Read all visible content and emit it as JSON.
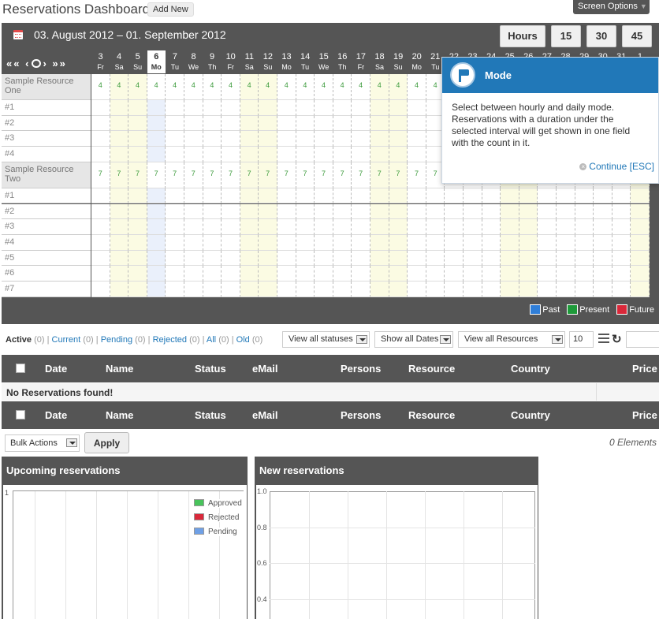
{
  "header": {
    "title": "Reservations Dashboard",
    "add_new": "Add New",
    "screen_options": "Screen Options",
    "screen_options_icon": "chevron-down-icon"
  },
  "calendar": {
    "range": "03. August 2012 – 01. September 2012",
    "modes": [
      "Hours",
      "15",
      "30",
      "45"
    ],
    "nav": {
      "first": "«",
      "prev_month": "«",
      "prev": "‹",
      "next": "›",
      "next_month": "»",
      "last": "»"
    },
    "days": [
      {
        "n": "3",
        "d": "Fr"
      },
      {
        "n": "4",
        "d": "Sa"
      },
      {
        "n": "5",
        "d": "Su"
      },
      {
        "n": "6",
        "d": "Mo"
      },
      {
        "n": "7",
        "d": "Tu"
      },
      {
        "n": "8",
        "d": "We"
      },
      {
        "n": "9",
        "d": "Th"
      },
      {
        "n": "10",
        "d": "Fr"
      },
      {
        "n": "11",
        "d": "Sa"
      },
      {
        "n": "12",
        "d": "Su"
      },
      {
        "n": "13",
        "d": "Mo"
      },
      {
        "n": "14",
        "d": "Tu"
      },
      {
        "n": "15",
        "d": "We"
      },
      {
        "n": "16",
        "d": "Th"
      },
      {
        "n": "17",
        "d": "Fr"
      },
      {
        "n": "18",
        "d": "Sa"
      },
      {
        "n": "19",
        "d": "Su"
      },
      {
        "n": "20",
        "d": "Mo"
      },
      {
        "n": "21",
        "d": "Tu"
      },
      {
        "n": "22",
        "d": "We"
      },
      {
        "n": "23",
        "d": "Th"
      },
      {
        "n": "24",
        "d": "Fr"
      },
      {
        "n": "25",
        "d": "Sa"
      },
      {
        "n": "26",
        "d": "Su"
      },
      {
        "n": "27",
        "d": "Mo"
      },
      {
        "n": "28",
        "d": "Tu"
      },
      {
        "n": "29",
        "d": "We"
      },
      {
        "n": "30",
        "d": "Th"
      },
      {
        "n": "31",
        "d": "Fr"
      },
      {
        "n": "1",
        "d": "Sa"
      }
    ],
    "today_index": 3,
    "resources": [
      {
        "name": "Sample Resource One",
        "count": "4",
        "rows": [
          "#1",
          "#2",
          "#3",
          "#4"
        ]
      },
      {
        "name": "Sample Resource Two",
        "count": "7",
        "rows": [
          "#1",
          "#2",
          "#3",
          "#4",
          "#5",
          "#6",
          "#7"
        ]
      }
    ],
    "legend": [
      {
        "label": "Past",
        "color": "#2f7ed8"
      },
      {
        "label": "Present",
        "color": "#1e9a3a"
      },
      {
        "label": "Future",
        "color": "#d9283a"
      }
    ]
  },
  "popup": {
    "title": "Mode",
    "text": "Select between hourly and daily mode. Reservations with a duration under the selected interval will get shown in one field with the count in it.",
    "continue": "Continue [ESC]"
  },
  "filters": {
    "links": [
      {
        "label": "Active",
        "count": "(0)"
      },
      {
        "label": "Current",
        "count": "(0)"
      },
      {
        "label": "Pending",
        "count": "(0)"
      },
      {
        "label": "Rejected",
        "count": "(0)"
      },
      {
        "label": "All",
        "count": "(0)"
      },
      {
        "label": "Old",
        "count": "(0)"
      }
    ],
    "status_select": "View all statuses",
    "date_select": "Show all Dates",
    "resource_select": "View all Resources",
    "per_page": "10"
  },
  "table": {
    "columns": [
      "Date",
      "Name",
      "Status",
      "eMail",
      "Persons",
      "Resource",
      "Country",
      "Price"
    ],
    "empty": "No Reservations found!"
  },
  "bulk": {
    "select": "Bulk Actions",
    "apply": "Apply",
    "count": "0 Elements"
  },
  "panels": {
    "upcoming": {
      "title": "Upcoming reservations",
      "y_label": "1",
      "legend": [
        {
          "label": "Approved",
          "color": "#48c35b"
        },
        {
          "label": "Rejected",
          "color": "#d9283a"
        },
        {
          "label": "Pending",
          "color": "#6fa0e6"
        }
      ]
    },
    "new": {
      "title": "New reservations",
      "y_ticks": [
        "1.0",
        "0.8",
        "0.6",
        "0.4"
      ]
    }
  }
}
